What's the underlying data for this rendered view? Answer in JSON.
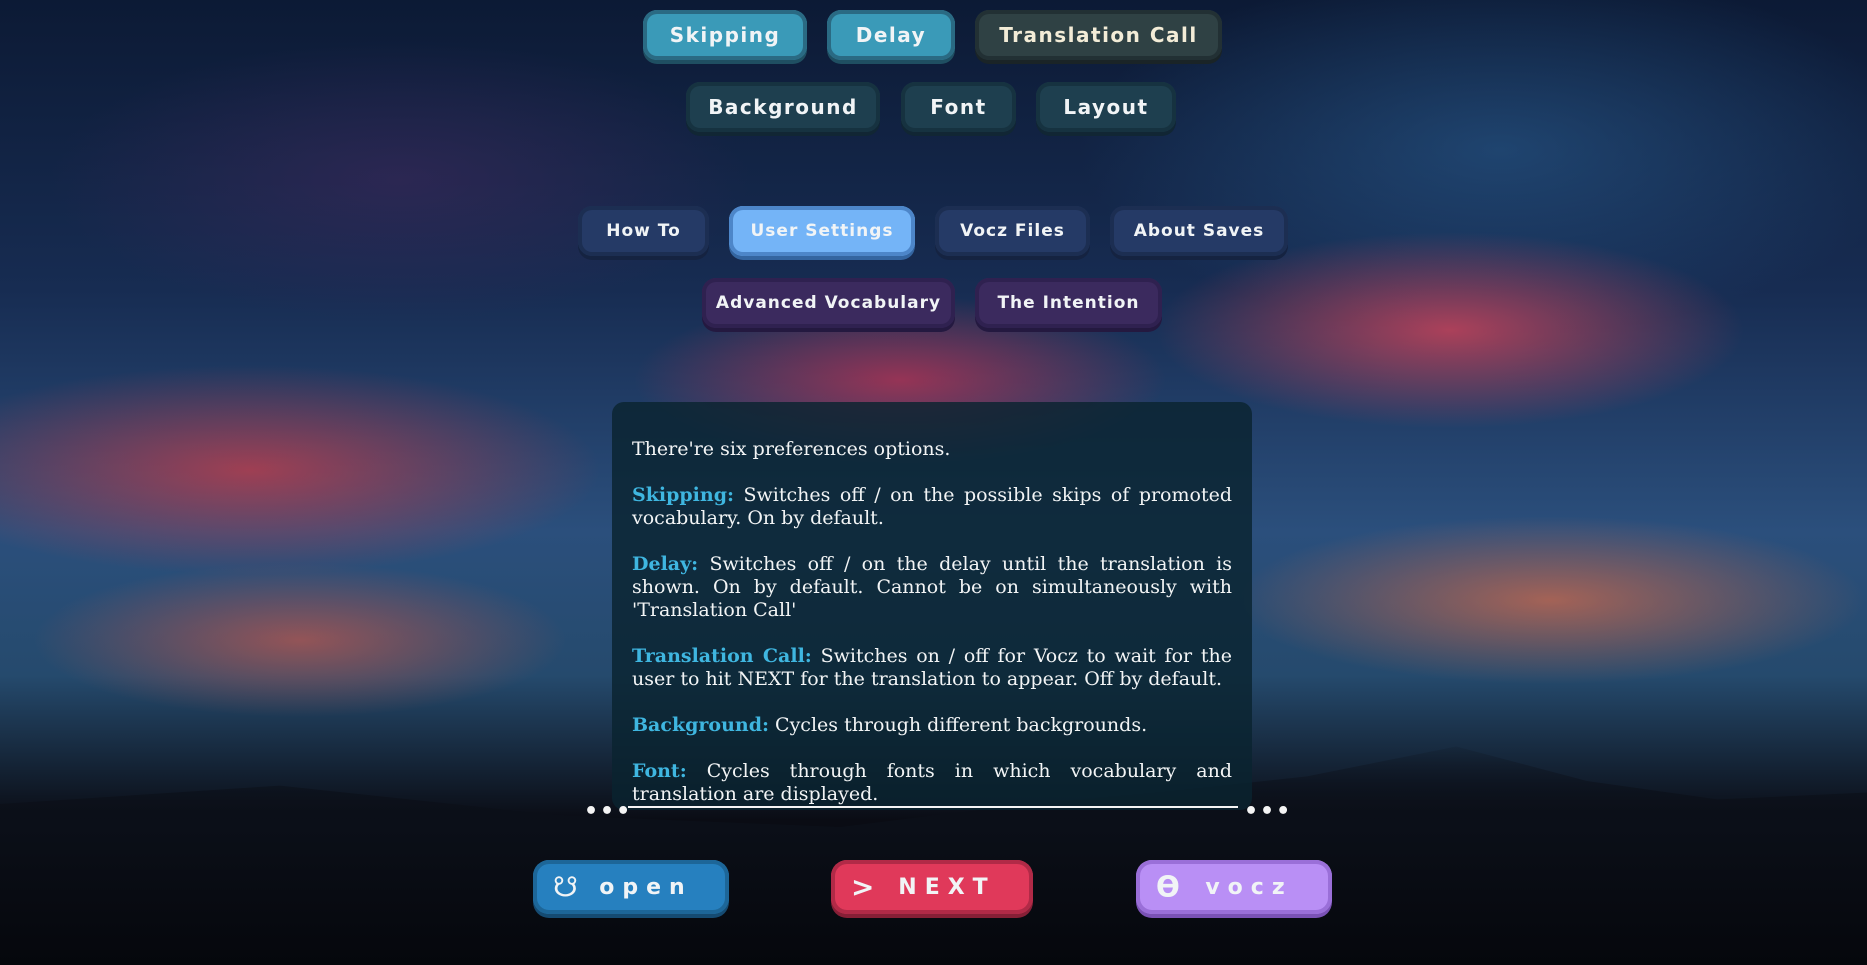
{
  "preferences": {
    "row1": [
      {
        "label": "Skipping"
      },
      {
        "label": "Delay"
      },
      {
        "label": "Translation Call"
      }
    ],
    "row2": [
      {
        "label": "Background"
      },
      {
        "label": "Font"
      },
      {
        "label": "Layout"
      }
    ]
  },
  "nav": {
    "row1": [
      {
        "label": "How To"
      },
      {
        "label": "User Settings"
      },
      {
        "label": "Vocz Files"
      },
      {
        "label": "About Saves"
      }
    ],
    "row2": [
      {
        "label": "Advanced Vocabulary"
      },
      {
        "label": "The Intention"
      }
    ]
  },
  "panel": {
    "intro": "There're six preferences options.",
    "items": [
      {
        "key": "Skipping:",
        "text": " Switches off / on the possible skips of promoted vocabulary. On by default."
      },
      {
        "key": "Delay:",
        "text": " Switches off / on the delay until the translation is shown. On by default. Cannot be on simultaneously with 'Translation Call'"
      },
      {
        "key": "Translation Call:",
        "text": " Switches on / off for Vocz to wait for the user to hit NEXT for the translation to appear. Off by default."
      },
      {
        "key": "Background:",
        "text": " Cycles through different backgrounds."
      },
      {
        "key": "Font:",
        "text": " Cycles through fonts in which vocabulary and translation are displayed."
      }
    ]
  },
  "bottom": {
    "open": {
      "label": "open",
      "icon": "ring-icon"
    },
    "next": {
      "label": "NEXT",
      "icon": "arrow-right-icon"
    },
    "vocz": {
      "label": "vocz",
      "icon": "theta-icon"
    }
  },
  "colors": {
    "keyword": "#3fb6e0",
    "open": "#2680bf",
    "next": "#e0395a",
    "vocz": "#b98ff5",
    "active_nav": "#74b4f7"
  }
}
